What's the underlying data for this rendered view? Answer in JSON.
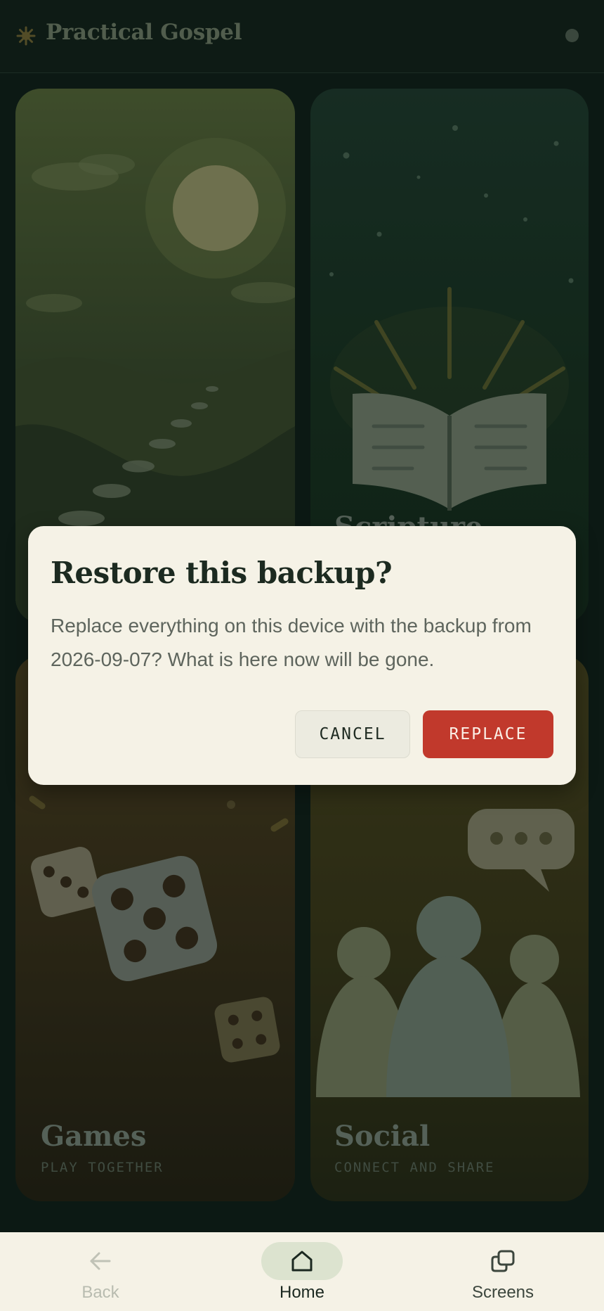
{
  "app": {
    "title": "Practical Gospel",
    "brand_icon": "sunburst-icon",
    "accent": "#7a6a35"
  },
  "cards": {
    "nature": {
      "title": "",
      "subtitle": ""
    },
    "scripture": {
      "title": "Scripture",
      "subtitle": ""
    },
    "games": {
      "title": "Games",
      "subtitle": "PLAY TOGETHER"
    },
    "social": {
      "title": "Social",
      "subtitle": "CONNECT AND SHARE"
    }
  },
  "dialog": {
    "title": "Restore this backup?",
    "message": "Replace everything on this device with the backup from 2026-09-07? What is here now will be gone.",
    "cancel_label": "CANCEL",
    "confirm_label": "REPLACE",
    "confirm_color": "#c1392c"
  },
  "nav": {
    "items": [
      {
        "label": "Back",
        "icon": "arrow-left-icon",
        "enabled": false
      },
      {
        "label": "Home",
        "icon": "home-icon",
        "active": true
      },
      {
        "label": "Screens",
        "icon": "screens-icon"
      }
    ]
  }
}
